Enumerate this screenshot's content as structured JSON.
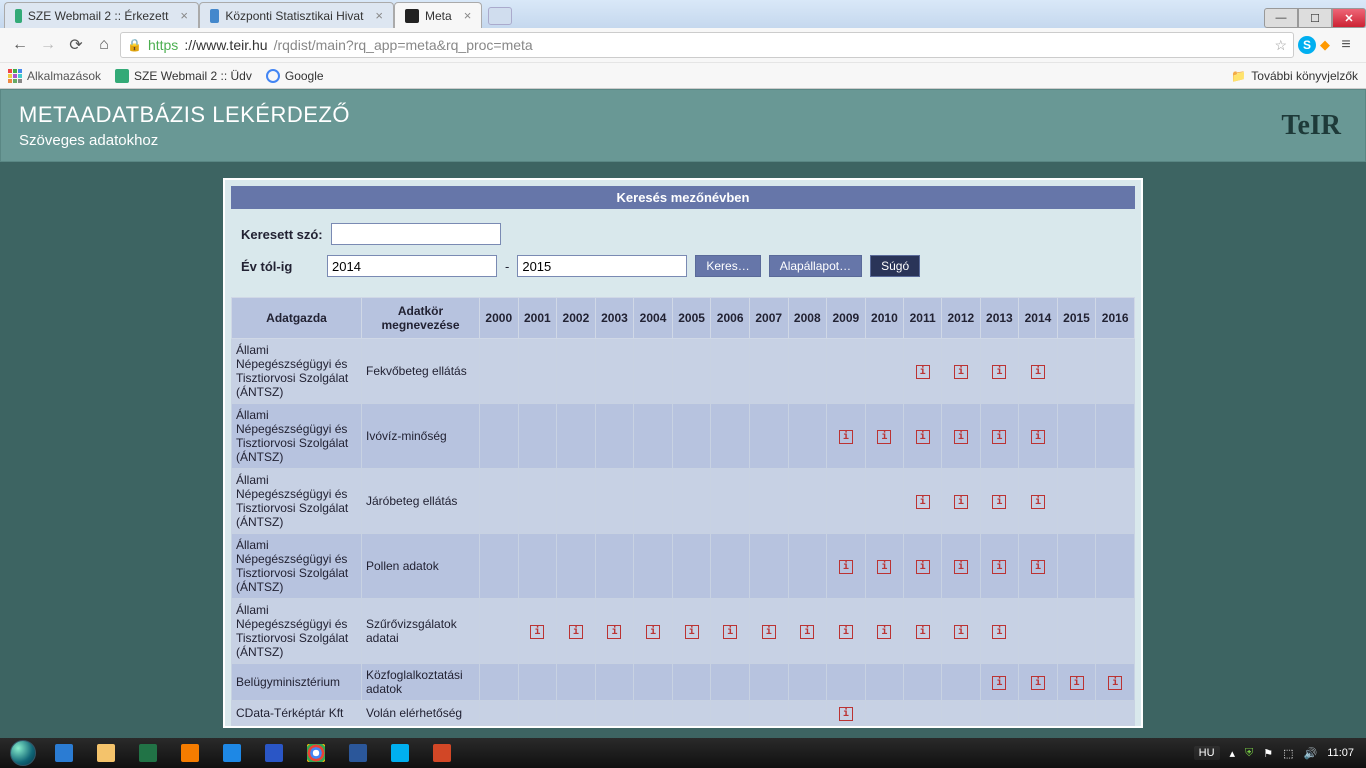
{
  "browser": {
    "tabs": [
      {
        "title": "SZE Webmail 2 :: Érkezett"
      },
      {
        "title": "Központi Statisztikai Hivat"
      },
      {
        "title": "Meta"
      }
    ],
    "url_protocol": "https",
    "url_host": "://www.teir.hu",
    "url_path": "/rqdist/main?rq_app=meta&rq_proc=meta",
    "bookmarks": {
      "apps": "Alkalmazások",
      "b1": "SZE Webmail 2 :: Üdv",
      "b2": "Google",
      "more": "További könyvjelzők"
    }
  },
  "page": {
    "header_title": "METAADATBÁZIS LEKÉRDEZŐ",
    "header_sub": "Szöveges adatokhoz",
    "logo": "TeIR",
    "section_title": "Keresés mezőnévben",
    "form": {
      "keresett_label": "Keresett szó:",
      "keresett_value": "",
      "ev_label": "Év tól-ig",
      "ev_from": "2014",
      "ev_to": "2015",
      "btn_search": "Keres…",
      "btn_reset": "Alapállapot…",
      "btn_help": "Súgó"
    },
    "table": {
      "col_adatgazda": "Adatgazda",
      "col_adatkor": "Adatkör megnevezése",
      "years": [
        "2000",
        "2001",
        "2002",
        "2003",
        "2004",
        "2005",
        "2006",
        "2007",
        "2008",
        "2009",
        "2010",
        "2011",
        "2012",
        "2013",
        "2014",
        "2015",
        "2016"
      ],
      "rows": [
        {
          "adatgazda": "Állami Népegészségügyi és Tisztiorvosi Szolgálat (ÁNTSZ)",
          "adatkor": "Fekvőbeteg ellátás",
          "marks": [
            "2011",
            "2012",
            "2013",
            "2014"
          ]
        },
        {
          "adatgazda": "Állami Népegészségügyi és Tisztiorvosi Szolgálat (ÁNTSZ)",
          "adatkor": "Ivóvíz-minőség",
          "marks": [
            "2009",
            "2010",
            "2011",
            "2012",
            "2013",
            "2014"
          ]
        },
        {
          "adatgazda": "Állami Népegészségügyi és Tisztiorvosi Szolgálat (ÁNTSZ)",
          "adatkor": "Járóbeteg ellátás",
          "marks": [
            "2011",
            "2012",
            "2013",
            "2014"
          ]
        },
        {
          "adatgazda": "Állami Népegészségügyi és Tisztiorvosi Szolgálat (ÁNTSZ)",
          "adatkor": "Pollen adatok",
          "marks": [
            "2009",
            "2010",
            "2011",
            "2012",
            "2013",
            "2014"
          ]
        },
        {
          "adatgazda": "Állami Népegészségügyi és Tisztiorvosi Szolgálat (ÁNTSZ)",
          "adatkor": "Szűrővizsgálatok adatai",
          "marks": [
            "2001",
            "2002",
            "2003",
            "2004",
            "2005",
            "2006",
            "2007",
            "2008",
            "2009",
            "2010",
            "2011",
            "2012",
            "2013"
          ]
        },
        {
          "adatgazda": "Belügyminisztérium",
          "adatkor": "Közfoglalkoztatási adatok",
          "marks": [
            "2013",
            "2014",
            "2015",
            "2016"
          ]
        },
        {
          "adatgazda": "CData-Térképtár Kft",
          "adatkor": "Volán elérhetőség",
          "marks": [
            "2009"
          ]
        }
      ],
      "info_glyph": "i"
    }
  },
  "taskbar": {
    "lang": "HU",
    "clock": "11:07"
  }
}
